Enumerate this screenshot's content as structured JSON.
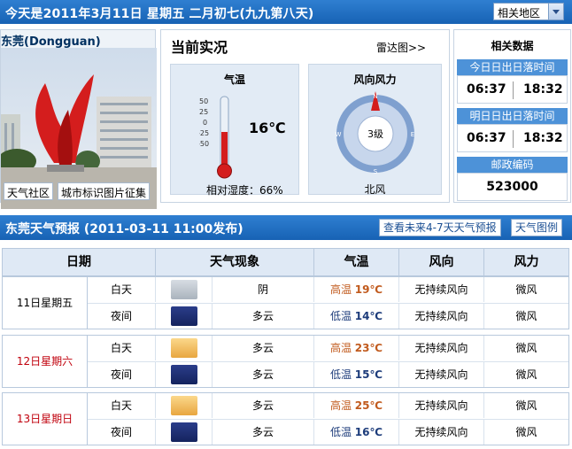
{
  "header": {
    "date_text": "今天是2011年3月11日  星期五  二月初七(九九第八天)",
    "region_select": "相关地区"
  },
  "city": {
    "name": "东莞(Dongguan)",
    "links": [
      "天气社区",
      "城市标识图片征集"
    ]
  },
  "current": {
    "title": "当前实况",
    "radar_link": "雷达图>>",
    "temperature_heading": "气温",
    "temperature": "16℃",
    "temperature_value": 16,
    "thermometer_ticks": [
      "50",
      "25",
      "0",
      "-25",
      "-50"
    ],
    "humidity_text": "相对湿度：66%",
    "wind_heading": "风向风力",
    "wind_level": "3级",
    "wind_direction": "北风",
    "compass_letters": [
      "N",
      "E",
      "S",
      "W"
    ]
  },
  "related": {
    "title": "相关数据",
    "today_label": "今日日出日落时间",
    "today_sunrise": "06:37",
    "today_sunset": "18:32",
    "tomorrow_label": "明日日出日落时间",
    "tomorrow_sunrise": "06:37",
    "tomorrow_sunset": "18:32",
    "postal_label": "邮政编码",
    "postal_code": "523000"
  },
  "forecast": {
    "title": "东莞天气预报 (2011-03-11  11:00发布)",
    "more_button": "查看未来4-7天天气预报",
    "legend_button": "天气图例",
    "headers": [
      "日期",
      "天气现象",
      "气温",
      "风向",
      "风力"
    ],
    "days": [
      {
        "date": "11日星期五",
        "highlight": false,
        "rows": [
          {
            "period": "白天",
            "icon": "cloudy-icon",
            "weather": "阴",
            "temp_label": "高温",
            "temp": "19℃",
            "wind_dir": "无持续风向",
            "wind_force": "微风"
          },
          {
            "period": "夜间",
            "icon": "moon-cloud-icon",
            "weather": "多云",
            "temp_label": "低温",
            "temp": "14℃",
            "wind_dir": "无持续风向",
            "wind_force": "微风"
          }
        ]
      },
      {
        "date": "12日星期六",
        "highlight": true,
        "rows": [
          {
            "period": "白天",
            "icon": "sun-cloud-icon",
            "weather": "多云",
            "temp_label": "高温",
            "temp": "23℃",
            "wind_dir": "无持续风向",
            "wind_force": "微风"
          },
          {
            "period": "夜间",
            "icon": "moon-cloud-icon",
            "weather": "多云",
            "temp_label": "低温",
            "temp": "15℃",
            "wind_dir": "无持续风向",
            "wind_force": "微风"
          }
        ]
      },
      {
        "date": "13日星期日",
        "highlight": true,
        "rows": [
          {
            "period": "白天",
            "icon": "sun-cloud-icon",
            "weather": "多云",
            "temp_label": "高温",
            "temp": "25℃",
            "wind_dir": "无持续风向",
            "wind_force": "微风"
          },
          {
            "period": "夜间",
            "icon": "moon-cloud-icon",
            "weather": "多云",
            "temp_label": "低温",
            "temp": "16℃",
            "wind_dir": "无持续风向",
            "wind_force": "微风"
          }
        ]
      }
    ]
  }
}
